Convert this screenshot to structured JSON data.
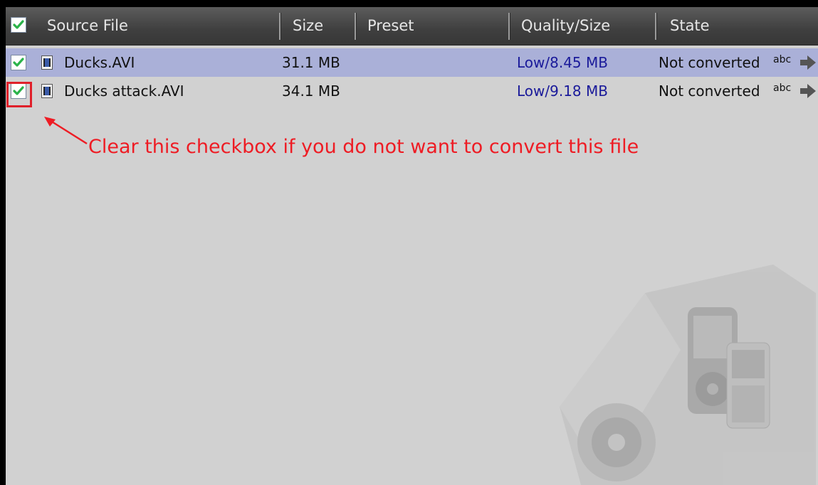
{
  "header": {
    "source_file": "Source File",
    "size": "Size",
    "preset": "Preset",
    "quality_size": "Quality/Size",
    "state": "State"
  },
  "rows": [
    {
      "checked": true,
      "file": "Ducks.AVI",
      "size": "31.1 MB",
      "preset": "",
      "quality_size": "Low/8.45 MB",
      "state": "Not converted",
      "badge": "abc"
    },
    {
      "checked": true,
      "file": "Ducks attack.AVI",
      "size": "34.1 MB",
      "preset": "",
      "quality_size": "Low/9.18 MB",
      "state": "Not converted",
      "badge": "abc"
    }
  ],
  "annotation": {
    "text": "Clear this checkbox if you do not want to convert this file"
  },
  "colors": {
    "panel_bg": "#d1d1d1",
    "header_bg": "#4a4a4a",
    "selected_row": "#aab0d8",
    "quality_text": "#1a1a9a",
    "annotation": "#ee1c24",
    "checkmark": "#2bb34a"
  },
  "icons": {
    "checkbox": "checkmark-icon",
    "file": "video-file-icon",
    "state_arrow": "arrow-right-icon",
    "annotation_arrow": "annotation-arrow-icon"
  }
}
